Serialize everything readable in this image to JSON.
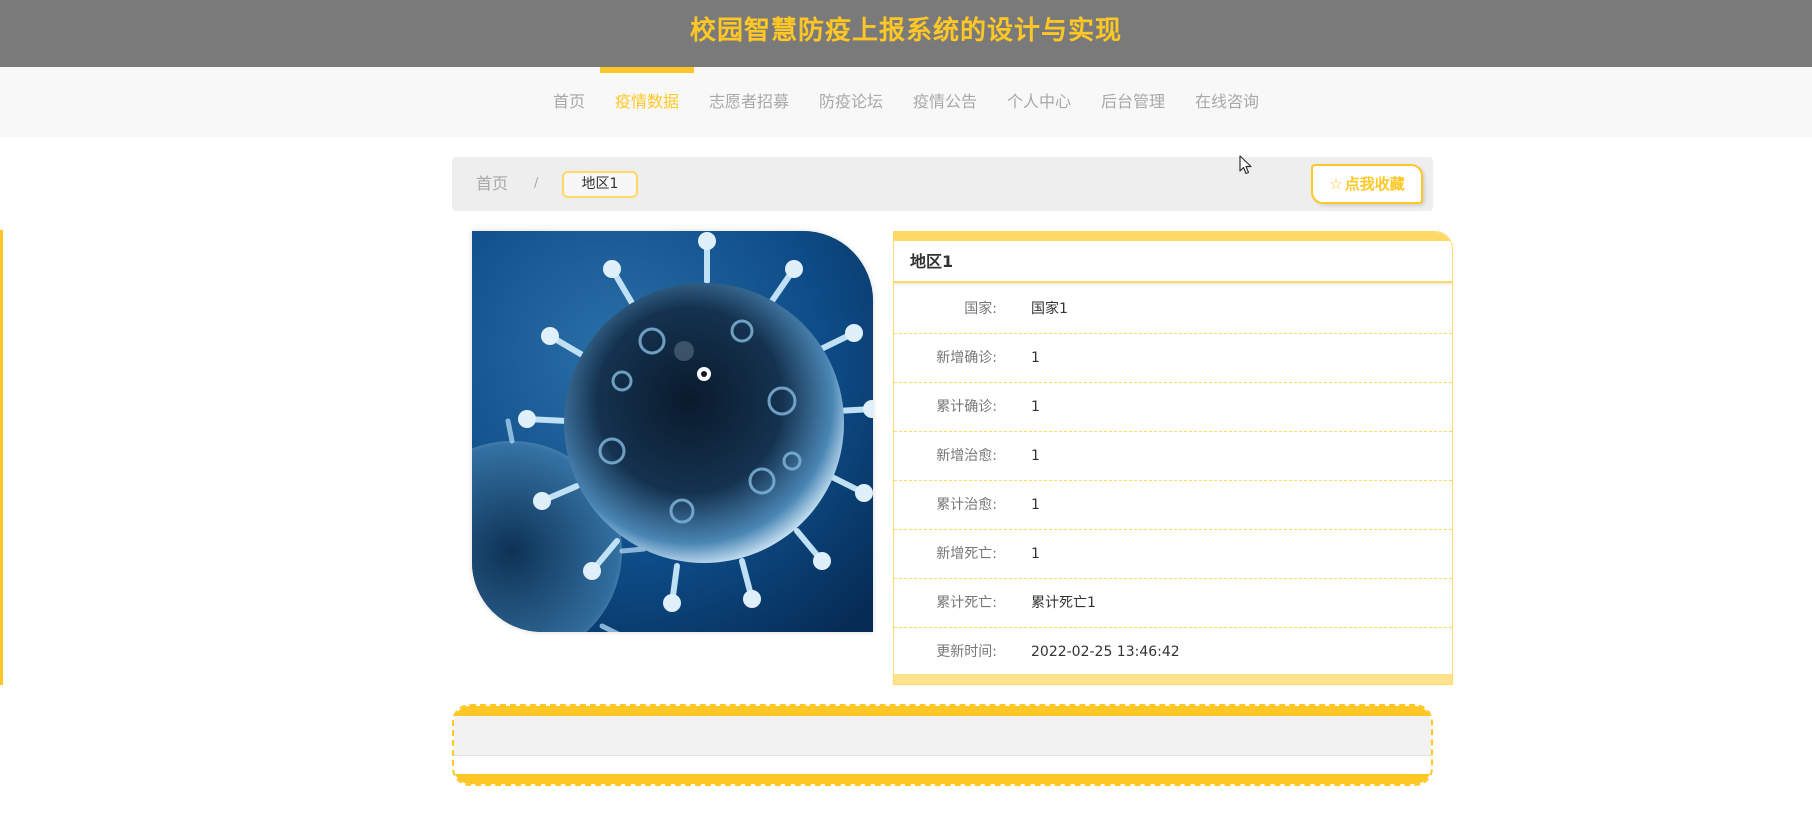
{
  "header": {
    "title": "校园智慧防疫上报系统的设计与实现"
  },
  "nav": {
    "items": [
      {
        "label": "首页"
      },
      {
        "label": "疫情数据",
        "active": true
      },
      {
        "label": "志愿者招募"
      },
      {
        "label": "防疫论坛"
      },
      {
        "label": "疫情公告"
      },
      {
        "label": "个人中心"
      },
      {
        "label": "后台管理"
      },
      {
        "label": "在线咨询"
      }
    ]
  },
  "breadcrumb": {
    "home": "首页",
    "separator": "/",
    "current": "地区1"
  },
  "favorite": {
    "icon": "star-icon",
    "label": "点我收藏"
  },
  "detail": {
    "title": "地区1",
    "rows": [
      {
        "label": "国家:",
        "value": "国家1"
      },
      {
        "label": "新增确诊:",
        "value": "1"
      },
      {
        "label": "累计确诊:",
        "value": "1"
      },
      {
        "label": "新增治愈:",
        "value": "1"
      },
      {
        "label": "累计治愈:",
        "value": "1"
      },
      {
        "label": "新增死亡:",
        "value": "1"
      },
      {
        "label": "累计死亡:",
        "value": "累计死亡1"
      },
      {
        "label": "更新时间:",
        "value": "2022-02-25 13:46:42"
      }
    ]
  },
  "colors": {
    "accent": "#ffc726",
    "accent_light": "#ffd966",
    "header_bg": "#7a7a7a",
    "nav_bg": "#f8f8f8"
  }
}
